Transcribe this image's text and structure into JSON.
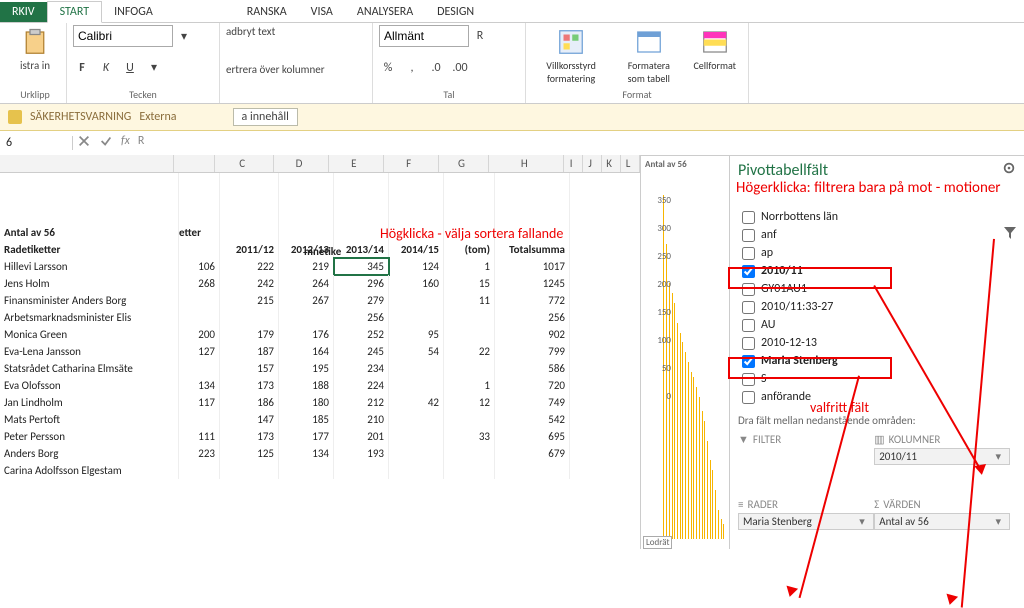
{
  "tabs": {
    "file": "RKIV",
    "start": "START",
    "infoga": "INFOGA",
    "granska": "RANSKA",
    "visa": "VISA",
    "analys": "ANALYSERA",
    "design": "DESIGN"
  },
  "ribbon": {
    "font_name": "Calibri",
    "font_group": "Tecken",
    "clipboard": "Urklipp",
    "bold": "F",
    "italic": "K",
    "underline": "U",
    "align_wrap": "adbryt text",
    "align_merge": "ertrera över kolumner",
    "align_group": "",
    "num_format": "Allmänt",
    "num_search": "R",
    "num_group": "Tal",
    "btn_cond": "Villkorsstyrd formatering",
    "btn_fmt": "Formatera som tabell",
    "btn_cell": "Cellformat",
    "format_group": "Format",
    "paste": "istra in"
  },
  "warn": {
    "label": "SÄKERHETSVARNING",
    "text": "Externa",
    "box": "a innehåll"
  },
  "addr": {
    "name": "6",
    "fx": "R"
  },
  "anno": {
    "sort": "Högklicka - välja sortera fallande",
    "filter": "Högerklicka: filtrera bara på mot - motioner",
    "valfritt": "valfritt fält"
  },
  "headers_row1": {
    "a": "Antal av 56",
    "b": "etter"
  },
  "col_years": [
    "2011/12",
    "2012/13",
    "2013/14",
    "2014/15",
    "(tom)",
    "Totalsumma"
  ],
  "row_label": "Radetiketter",
  "col_label": "mnetike",
  "rows": [
    {
      "n": "Hillevi Larsson",
      "v": [
        "106",
        "222",
        "219",
        "345",
        "124",
        "1",
        "1017"
      ]
    },
    {
      "n": "Jens Holm",
      "v": [
        "268",
        "242",
        "264",
        "296",
        "160",
        "15",
        "1245"
      ]
    },
    {
      "n": "Finansminister Anders Borg",
      "v": [
        "",
        "215",
        "267",
        "279",
        "",
        "11",
        "772"
      ]
    },
    {
      "n": "Arbetsmarknadsminister Elis",
      "v": [
        "",
        "",
        "",
        "256",
        "",
        "",
        "256"
      ]
    },
    {
      "n": "Monica Green",
      "v": [
        "200",
        "179",
        "176",
        "252",
        "95",
        "",
        "902"
      ]
    },
    {
      "n": "Eva-Lena Jansson",
      "v": [
        "127",
        "187",
        "164",
        "245",
        "54",
        "22",
        "799"
      ]
    },
    {
      "n": "Statsrådet Catharina Elmsäte",
      "v": [
        "",
        "157",
        "195",
        "234",
        "",
        "",
        "586"
      ]
    },
    {
      "n": "Eva Olofsson",
      "v": [
        "134",
        "173",
        "188",
        "224",
        "",
        "1",
        "720"
      ]
    },
    {
      "n": "Jan Lindholm",
      "v": [
        "117",
        "186",
        "180",
        "212",
        "42",
        "12",
        "749"
      ]
    },
    {
      "n": "Mats Pertoft",
      "v": [
        "",
        "147",
        "185",
        "210",
        "",
        "",
        "542"
      ]
    },
    {
      "n": "Peter Persson",
      "v": [
        "111",
        "173",
        "177",
        "201",
        "",
        "33",
        "695"
      ]
    },
    {
      "n": "Anders Borg",
      "v": [
        "223",
        "125",
        "134",
        "193",
        "",
        "",
        "679"
      ]
    },
    {
      "n": "Carina Adolfsson Elgestam",
      "v": [
        "",
        "",
        "",
        "",
        "",
        "",
        ""
      ]
    }
  ],
  "chart": {
    "title": "Antal av 56",
    "axis": [
      "350",
      "300",
      "250",
      "200",
      "150",
      "100",
      "50",
      "0"
    ],
    "lodr": "Lodrät"
  },
  "chart_data": {
    "type": "bar",
    "title": "Antal av 56",
    "xlabel": "",
    "ylabel": "",
    "ylim": [
      0,
      350
    ],
    "values": [
      350,
      300,
      300,
      260,
      260,
      250,
      250,
      240,
      235,
      220,
      215,
      210,
      200,
      195,
      190,
      185,
      180,
      175,
      170,
      165,
      160,
      155,
      150,
      145,
      140,
      130,
      120,
      110,
      100,
      90,
      80,
      70,
      60,
      50,
      40,
      30,
      25,
      20,
      15,
      10
    ]
  },
  "pane": {
    "title": "Pivottabellfält",
    "fields": [
      {
        "label": "Norrbottens län",
        "chk": false
      },
      {
        "label": "anf",
        "chk": false
      },
      {
        "label": "ap",
        "chk": false
      },
      {
        "label": "2010/11",
        "chk": true,
        "boxed": true
      },
      {
        "label": "GY01AU1",
        "chk": false
      },
      {
        "label": "2010/11:33-27",
        "chk": false
      },
      {
        "label": "AU",
        "chk": false
      },
      {
        "label": "2010-12-13",
        "chk": false
      },
      {
        "label": "Maria Stenberg",
        "chk": true,
        "boxed": true
      },
      {
        "label": "S",
        "chk": false
      },
      {
        "label": "anförande",
        "chk": false
      }
    ],
    "drag_caption": "Dra fält mellan nedanstående områden:",
    "filters": "FILTER",
    "columns": "KOLUMNER",
    "rows": "RADER",
    "values": "VÄRDEN",
    "col_item": "2010/11",
    "row_item": "Maria Stenberg",
    "val_item": "Antal av 56"
  }
}
